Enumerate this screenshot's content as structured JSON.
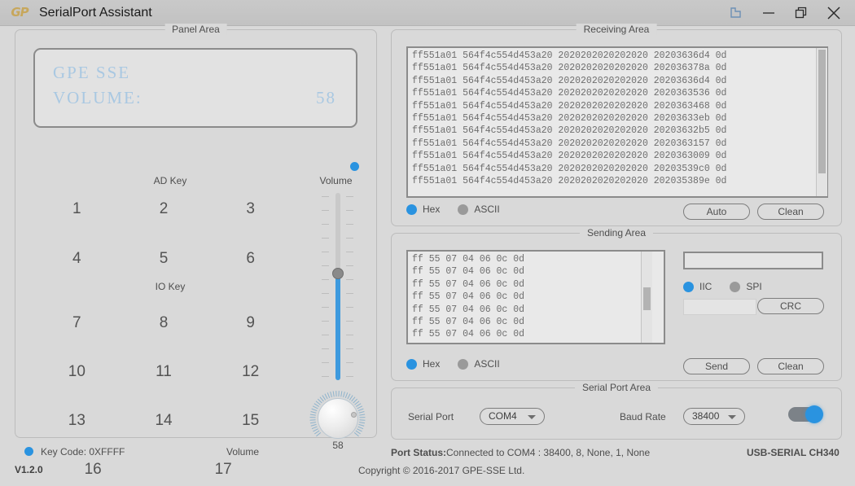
{
  "titlebar": {
    "logo": "GP",
    "title": "SerialPort Assistant",
    "buttons": [
      {
        "name": "pin-window-icon",
        "label": "pin"
      },
      {
        "name": "minimize-icon",
        "label": "minimize"
      },
      {
        "name": "maximize-icon",
        "label": "maximize"
      },
      {
        "name": "close-icon",
        "label": "close"
      }
    ]
  },
  "panel": {
    "title": "Panel Area",
    "lcd": {
      "line1": "GPE SSE",
      "line2": "VOLUME:",
      "value": "58"
    },
    "ad_key_label": "AD Key",
    "io_key_label": "IO Key",
    "volume_label": "Volume",
    "keys": [
      [
        "1",
        "2",
        "3"
      ],
      [
        "4",
        "5",
        "6"
      ],
      [
        "7",
        "8",
        "9"
      ],
      [
        "10",
        "11",
        "12"
      ],
      [
        "13",
        "14",
        "15"
      ],
      [
        "16",
        "17"
      ]
    ],
    "slider_value": 58,
    "knob_value": "58"
  },
  "receiving": {
    "title": "Receiving Area",
    "lines": [
      "ff551a01 564f4c554d453a20 2020202020202020 20203636d4 0d",
      "ff551a01 564f4c554d453a20 2020202020202020 202036378a 0d",
      "ff551a01 564f4c554d453a20 2020202020202020 20203636d4 0d",
      "ff551a01 564f4c554d453a20 2020202020202020 2020363536 0d",
      "ff551a01 564f4c554d453a20 2020202020202020 2020363468 0d",
      "ff551a01 564f4c554d453a20 2020202020202020 20203633eb 0d",
      "ff551a01 564f4c554d453a20 2020202020202020 20203632b5 0d",
      "ff551a01 564f4c554d453a20 2020202020202020 2020363157 0d",
      "ff551a01 564f4c554d453a20 2020202020202020 2020363009 0d",
      "ff551a01 564f4c554d453a20 2020202020202020 20203539c0 0d",
      "ff551a01 564f4c554d453a20 2020202020202020 202035389e 0d"
    ],
    "format_hex": "Hex",
    "format_ascii": "ASCII",
    "selected_format": "Hex",
    "auto_button": "Auto",
    "clean_button": "Clean"
  },
  "sending": {
    "title": "Sending Area",
    "lines": [
      "ff 55 07 04 06 0c 0d",
      "ff 55 07 04 06 0c 0d",
      "ff 55 07 04 06 0c 0d",
      "ff 55 07 04 06 0c 0d",
      "ff 55 07 04 06 0c 0d",
      "ff 55 07 04 06 0c 0d",
      "ff 55 07 04 06 0c 0d"
    ],
    "hex_input_value": "",
    "crc_input_value": "",
    "bus_iic": "IIC",
    "bus_spi": "SPI",
    "selected_bus": "IIC",
    "crc_button": "CRC",
    "format_hex": "Hex",
    "format_ascii": "ASCII",
    "selected_format": "Hex",
    "send_button": "Send",
    "clean_button": "Clean"
  },
  "serial": {
    "title": "Serial Port Area",
    "port_label": "Serial Port",
    "port_value": "COM4",
    "baud_label": "Baud Rate",
    "baud_value": "38400",
    "connected": true
  },
  "status": {
    "key_code": "Key Code: 0XFFFF",
    "volume": "Volume",
    "version": "V1.2.0",
    "copyright": "Copyright © 2016-2017 GPE-SSE Ltd.",
    "port_status_label": "Port Status:",
    "port_status_value": "Connected to COM4 : 38400, 8, None, 1, None",
    "device": "USB-SERIAL CH340"
  },
  "colors": {
    "accent": "#2a93e0",
    "lcd_text": "#a9c8e2",
    "background": "#d9d9d9"
  }
}
